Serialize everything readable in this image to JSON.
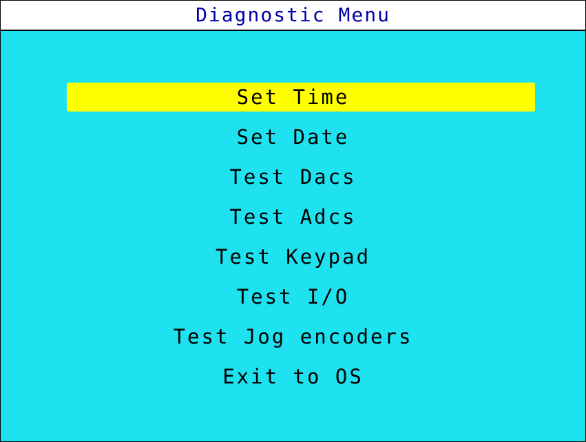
{
  "title": "Diagnostic Menu",
  "colors": {
    "background": "#1fe2f0",
    "title_bar": "#ffffff",
    "title_text": "#0000a8",
    "highlight": "#ffff00",
    "item_text": "#000000"
  },
  "menu": {
    "selected_index": 0,
    "items": [
      {
        "label": "Set Time"
      },
      {
        "label": "Set Date"
      },
      {
        "label": "Test Dacs"
      },
      {
        "label": "Test Adcs"
      },
      {
        "label": "Test Keypad"
      },
      {
        "label": "Test I/O"
      },
      {
        "label": "Test Jog encoders"
      },
      {
        "label": "Exit to OS"
      }
    ]
  }
}
